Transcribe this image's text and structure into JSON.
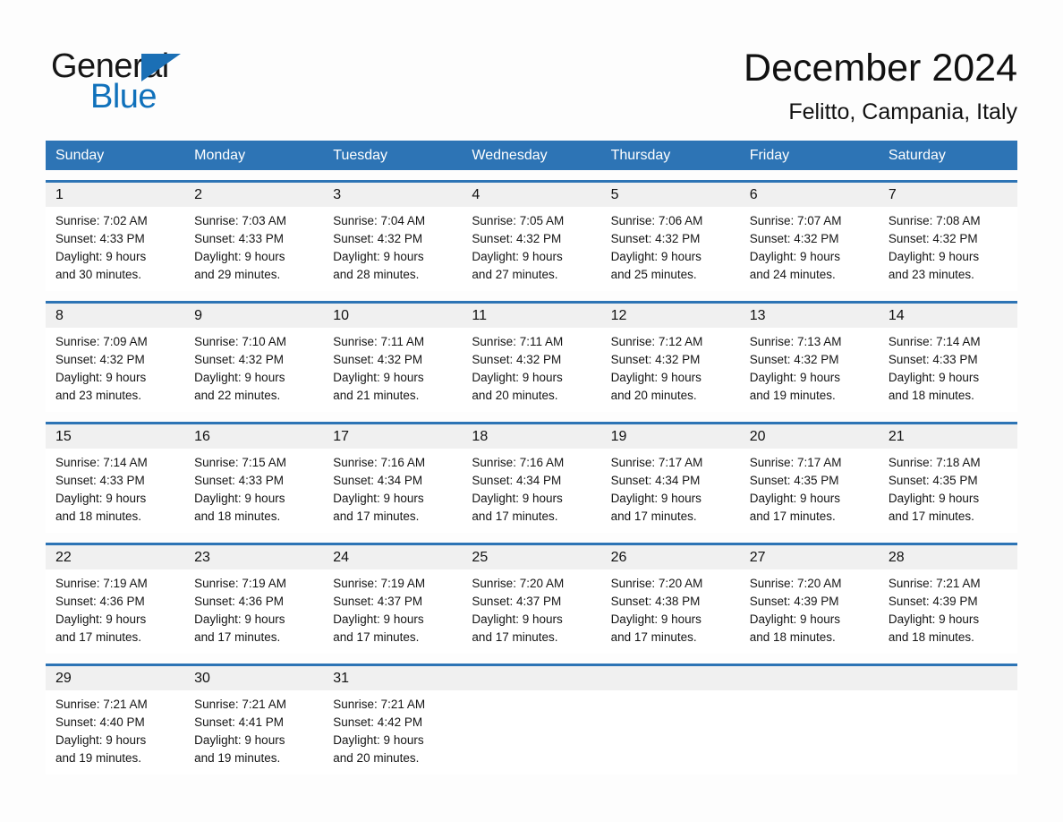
{
  "brand": {
    "word1": "General",
    "word2": "Blue",
    "triangle_color": "#1b6fb5",
    "text_color": "#161616",
    "blue_color": "#1071bb"
  },
  "header": {
    "month_title": "December 2024",
    "location": "Felitto, Campania, Italy"
  },
  "theme": {
    "header_blue": "#2d74b5",
    "row_rule_blue": "#2d74b5",
    "daynum_band": "#f0f0f0",
    "page_background": "#fdfdfd"
  },
  "weekdays": [
    "Sunday",
    "Monday",
    "Tuesday",
    "Wednesday",
    "Thursday",
    "Friday",
    "Saturday"
  ],
  "weeks": [
    {
      "numbers": [
        "1",
        "2",
        "3",
        "4",
        "5",
        "6",
        "7"
      ],
      "days": [
        {
          "sunrise": "Sunrise: 7:02 AM",
          "sunset": "Sunset: 4:33 PM",
          "daylight1": "Daylight: 9 hours",
          "daylight2": "and 30 minutes."
        },
        {
          "sunrise": "Sunrise: 7:03 AM",
          "sunset": "Sunset: 4:33 PM",
          "daylight1": "Daylight: 9 hours",
          "daylight2": "and 29 minutes."
        },
        {
          "sunrise": "Sunrise: 7:04 AM",
          "sunset": "Sunset: 4:32 PM",
          "daylight1": "Daylight: 9 hours",
          "daylight2": "and 28 minutes."
        },
        {
          "sunrise": "Sunrise: 7:05 AM",
          "sunset": "Sunset: 4:32 PM",
          "daylight1": "Daylight: 9 hours",
          "daylight2": "and 27 minutes."
        },
        {
          "sunrise": "Sunrise: 7:06 AM",
          "sunset": "Sunset: 4:32 PM",
          "daylight1": "Daylight: 9 hours",
          "daylight2": "and 25 minutes."
        },
        {
          "sunrise": "Sunrise: 7:07 AM",
          "sunset": "Sunset: 4:32 PM",
          "daylight1": "Daylight: 9 hours",
          "daylight2": "and 24 minutes."
        },
        {
          "sunrise": "Sunrise: 7:08 AM",
          "sunset": "Sunset: 4:32 PM",
          "daylight1": "Daylight: 9 hours",
          "daylight2": "and 23 minutes."
        }
      ]
    },
    {
      "numbers": [
        "8",
        "9",
        "10",
        "11",
        "12",
        "13",
        "14"
      ],
      "days": [
        {
          "sunrise": "Sunrise: 7:09 AM",
          "sunset": "Sunset: 4:32 PM",
          "daylight1": "Daylight: 9 hours",
          "daylight2": "and 23 minutes."
        },
        {
          "sunrise": "Sunrise: 7:10 AM",
          "sunset": "Sunset: 4:32 PM",
          "daylight1": "Daylight: 9 hours",
          "daylight2": "and 22 minutes."
        },
        {
          "sunrise": "Sunrise: 7:11 AM",
          "sunset": "Sunset: 4:32 PM",
          "daylight1": "Daylight: 9 hours",
          "daylight2": "and 21 minutes."
        },
        {
          "sunrise": "Sunrise: 7:11 AM",
          "sunset": "Sunset: 4:32 PM",
          "daylight1": "Daylight: 9 hours",
          "daylight2": "and 20 minutes."
        },
        {
          "sunrise": "Sunrise: 7:12 AM",
          "sunset": "Sunset: 4:32 PM",
          "daylight1": "Daylight: 9 hours",
          "daylight2": "and 20 minutes."
        },
        {
          "sunrise": "Sunrise: 7:13 AM",
          "sunset": "Sunset: 4:32 PM",
          "daylight1": "Daylight: 9 hours",
          "daylight2": "and 19 minutes."
        },
        {
          "sunrise": "Sunrise: 7:14 AM",
          "sunset": "Sunset: 4:33 PM",
          "daylight1": "Daylight: 9 hours",
          "daylight2": "and 18 minutes."
        }
      ]
    },
    {
      "numbers": [
        "15",
        "16",
        "17",
        "18",
        "19",
        "20",
        "21"
      ],
      "days": [
        {
          "sunrise": "Sunrise: 7:14 AM",
          "sunset": "Sunset: 4:33 PM",
          "daylight1": "Daylight: 9 hours",
          "daylight2": "and 18 minutes."
        },
        {
          "sunrise": "Sunrise: 7:15 AM",
          "sunset": "Sunset: 4:33 PM",
          "daylight1": "Daylight: 9 hours",
          "daylight2": "and 18 minutes."
        },
        {
          "sunrise": "Sunrise: 7:16 AM",
          "sunset": "Sunset: 4:34 PM",
          "daylight1": "Daylight: 9 hours",
          "daylight2": "and 17 minutes."
        },
        {
          "sunrise": "Sunrise: 7:16 AM",
          "sunset": "Sunset: 4:34 PM",
          "daylight1": "Daylight: 9 hours",
          "daylight2": "and 17 minutes."
        },
        {
          "sunrise": "Sunrise: 7:17 AM",
          "sunset": "Sunset: 4:34 PM",
          "daylight1": "Daylight: 9 hours",
          "daylight2": "and 17 minutes."
        },
        {
          "sunrise": "Sunrise: 7:17 AM",
          "sunset": "Sunset: 4:35 PM",
          "daylight1": "Daylight: 9 hours",
          "daylight2": "and 17 minutes."
        },
        {
          "sunrise": "Sunrise: 7:18 AM",
          "sunset": "Sunset: 4:35 PM",
          "daylight1": "Daylight: 9 hours",
          "daylight2": "and 17 minutes."
        }
      ]
    },
    {
      "numbers": [
        "22",
        "23",
        "24",
        "25",
        "26",
        "27",
        "28"
      ],
      "days": [
        {
          "sunrise": "Sunrise: 7:19 AM",
          "sunset": "Sunset: 4:36 PM",
          "daylight1": "Daylight: 9 hours",
          "daylight2": "and 17 minutes."
        },
        {
          "sunrise": "Sunrise: 7:19 AM",
          "sunset": "Sunset: 4:36 PM",
          "daylight1": "Daylight: 9 hours",
          "daylight2": "and 17 minutes."
        },
        {
          "sunrise": "Sunrise: 7:19 AM",
          "sunset": "Sunset: 4:37 PM",
          "daylight1": "Daylight: 9 hours",
          "daylight2": "and 17 minutes."
        },
        {
          "sunrise": "Sunrise: 7:20 AM",
          "sunset": "Sunset: 4:37 PM",
          "daylight1": "Daylight: 9 hours",
          "daylight2": "and 17 minutes."
        },
        {
          "sunrise": "Sunrise: 7:20 AM",
          "sunset": "Sunset: 4:38 PM",
          "daylight1": "Daylight: 9 hours",
          "daylight2": "and 17 minutes."
        },
        {
          "sunrise": "Sunrise: 7:20 AM",
          "sunset": "Sunset: 4:39 PM",
          "daylight1": "Daylight: 9 hours",
          "daylight2": "and 18 minutes."
        },
        {
          "sunrise": "Sunrise: 7:21 AM",
          "sunset": "Sunset: 4:39 PM",
          "daylight1": "Daylight: 9 hours",
          "daylight2": "and 18 minutes."
        }
      ]
    },
    {
      "numbers": [
        "29",
        "30",
        "31",
        "",
        "",
        "",
        ""
      ],
      "days": [
        {
          "sunrise": "Sunrise: 7:21 AM",
          "sunset": "Sunset: 4:40 PM",
          "daylight1": "Daylight: 9 hours",
          "daylight2": "and 19 minutes."
        },
        {
          "sunrise": "Sunrise: 7:21 AM",
          "sunset": "Sunset: 4:41 PM",
          "daylight1": "Daylight: 9 hours",
          "daylight2": "and 19 minutes."
        },
        {
          "sunrise": "Sunrise: 7:21 AM",
          "sunset": "Sunset: 4:42 PM",
          "daylight1": "Daylight: 9 hours",
          "daylight2": "and 20 minutes."
        },
        {
          "sunrise": "",
          "sunset": "",
          "daylight1": "",
          "daylight2": ""
        },
        {
          "sunrise": "",
          "sunset": "",
          "daylight1": "",
          "daylight2": ""
        },
        {
          "sunrise": "",
          "sunset": "",
          "daylight1": "",
          "daylight2": ""
        },
        {
          "sunrise": "",
          "sunset": "",
          "daylight1": "",
          "daylight2": ""
        }
      ]
    }
  ]
}
